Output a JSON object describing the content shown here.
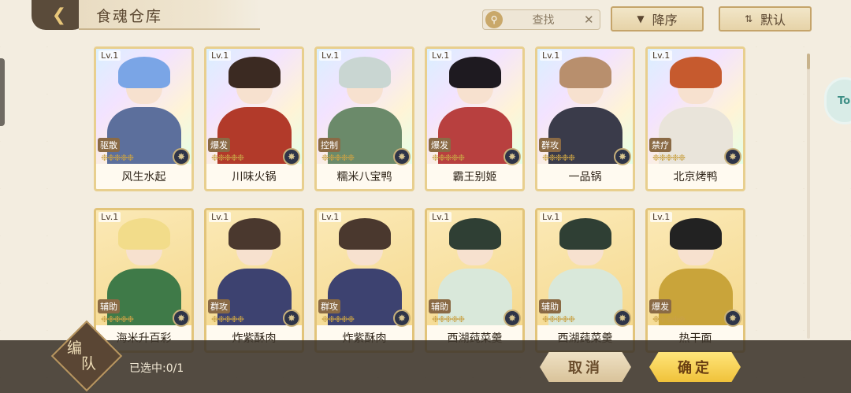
{
  "header": {
    "title": "食魂仓库",
    "search_placeholder": "查找",
    "sort_order_label": "降序",
    "sort_mode_label": "默认"
  },
  "side_float_label": "To",
  "cards": [
    {
      "level": "Lv.1",
      "role": "驱散",
      "name": "风生水起",
      "frame": "rainbow",
      "hair": "#7aa5e6",
      "body": "#5c6f9c"
    },
    {
      "level": "Lv.1",
      "role": "爆发",
      "name": "川味火锅",
      "frame": "rainbow",
      "hair": "#3b2a22",
      "body": "#b23a2a"
    },
    {
      "level": "Lv.1",
      "role": "控制",
      "name": "糯米八宝鸭",
      "frame": "rainbow",
      "hair": "#c9d6d2",
      "body": "#6b8a6a"
    },
    {
      "level": "Lv.1",
      "role": "爆发",
      "name": "霸王别姬",
      "frame": "rainbow",
      "hair": "#1e1a20",
      "body": "#b8403f"
    },
    {
      "level": "Lv.1",
      "role": "群攻",
      "name": "一品锅",
      "frame": "rainbow",
      "hair": "#b88f6d",
      "body": "#3a3b4a"
    },
    {
      "level": "Lv.1",
      "role": "禁疗",
      "name": "北京烤鸭",
      "frame": "rainbow",
      "hair": "#c65a2e",
      "body": "#e9e4da"
    },
    {
      "level": "Lv.1",
      "role": "辅助",
      "name": "海米升百彩",
      "frame": "gold",
      "hair": "#f2dc8a",
      "body": "#3f7a48"
    },
    {
      "level": "Lv.1",
      "role": "群攻",
      "name": "炸紫酥肉",
      "frame": "gold",
      "hair": "#4a382e",
      "body": "#3d4270"
    },
    {
      "level": "Lv.1",
      "role": "群攻",
      "name": "炸紫酥肉",
      "frame": "gold",
      "hair": "#4a382e",
      "body": "#3d4270"
    },
    {
      "level": "Lv.1",
      "role": "辅助",
      "name": "西湖莼菜羹",
      "frame": "gold",
      "hair": "#2f3f34",
      "body": "#d9e8da"
    },
    {
      "level": "Lv.1",
      "role": "辅助",
      "name": "西湖莼菜羹",
      "frame": "gold",
      "hair": "#2f3f34",
      "body": "#d9e8da"
    },
    {
      "level": "Lv.1",
      "role": "爆发",
      "name": "热干面",
      "frame": "gold",
      "hair": "#222222",
      "body": "#c9a43a"
    }
  ],
  "footer": {
    "team_label_1": "编",
    "team_label_2": "队",
    "selected_text": "已选中:0/1",
    "cancel_label": "取消",
    "confirm_label": "确定"
  },
  "colors": {
    "accent_gold": "#f0c23a",
    "bar_dark": "#3c342a"
  }
}
